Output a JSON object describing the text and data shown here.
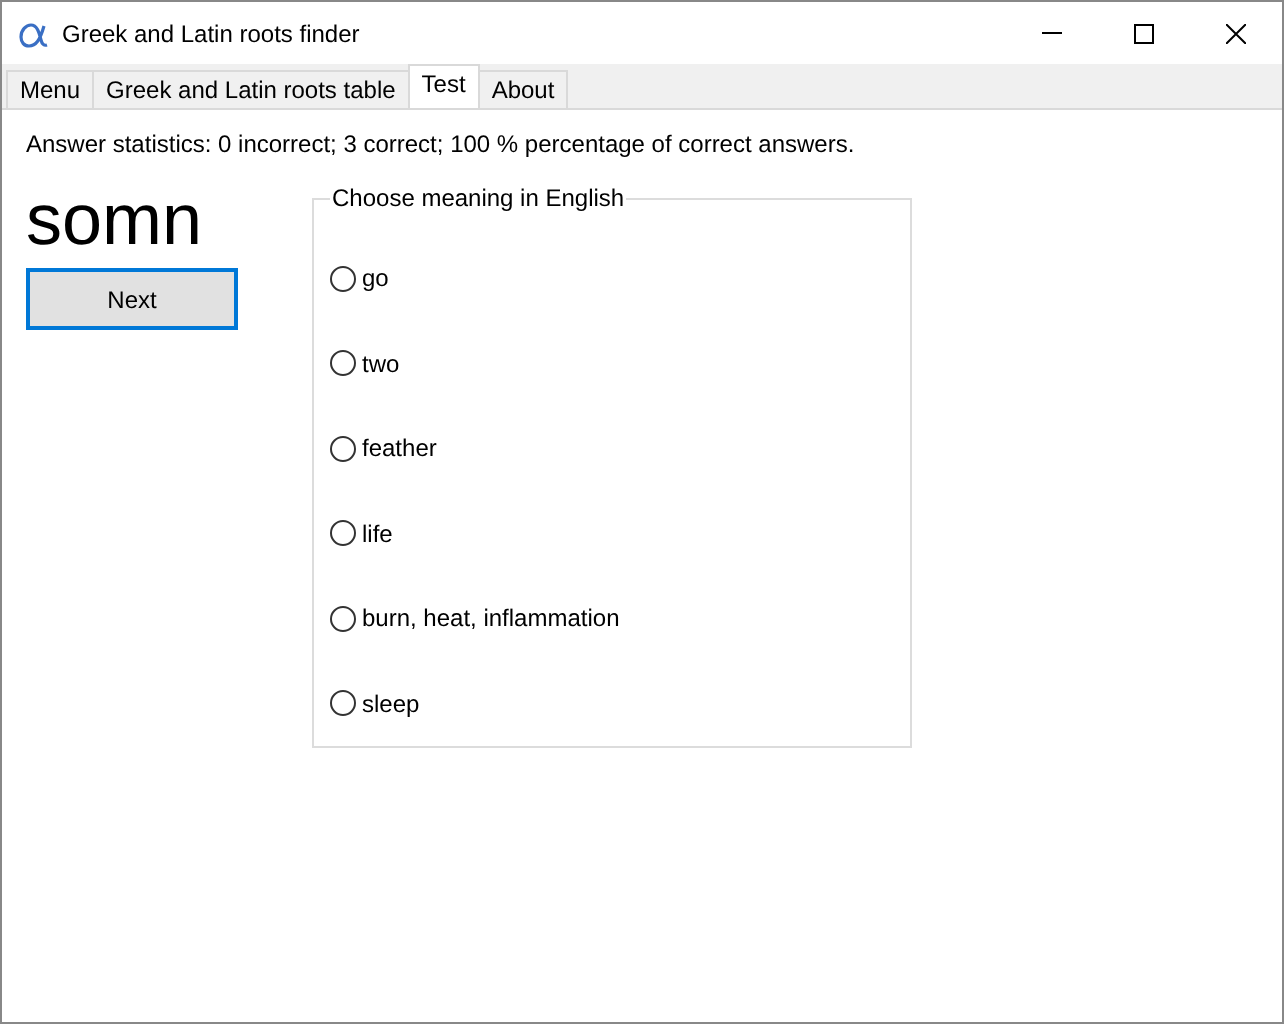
{
  "window": {
    "title": "Greek and Latin roots finder"
  },
  "tabs": [
    {
      "label": "Menu",
      "selected": false
    },
    {
      "label": "Greek and Latin roots table",
      "selected": false
    },
    {
      "label": "Test",
      "selected": true
    },
    {
      "label": "About",
      "selected": false
    }
  ],
  "statistics": "Answer statistics: 0 incorrect; 3 correct; 100 % percentage of correct answers.",
  "root": "somn",
  "next_button": "Next",
  "choices": {
    "legend": "Choose meaning in English",
    "options": [
      {
        "label": "go",
        "selected": false
      },
      {
        "label": "two",
        "selected": false
      },
      {
        "label": "feather",
        "selected": false
      },
      {
        "label": "life",
        "selected": false
      },
      {
        "label": "burn, heat, inflammation",
        "selected": false
      },
      {
        "label": "sleep",
        "selected": false
      }
    ]
  }
}
